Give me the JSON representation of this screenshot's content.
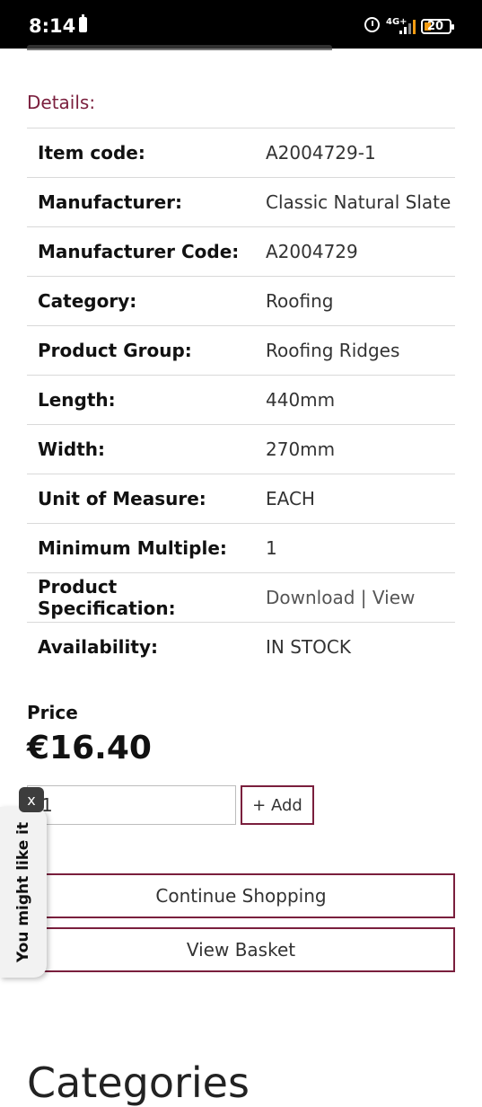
{
  "status_bar": {
    "time": "8:14",
    "network": "4G+",
    "battery": "20"
  },
  "details": {
    "heading": "Details:",
    "rows": [
      {
        "label": "Item code:",
        "value": "A2004729-1"
      },
      {
        "label": "Manufacturer:",
        "value": "Classic Natural Slate"
      },
      {
        "label": "Manufacturer Code:",
        "value": "A2004729"
      },
      {
        "label": "Category:",
        "value": "Roofing"
      },
      {
        "label": "Product Group:",
        "value": "Roofing Ridges"
      },
      {
        "label": "Length:",
        "value": "440mm"
      },
      {
        "label": "Width:",
        "value": "270mm"
      },
      {
        "label": "Unit of Measure:",
        "value": "EACH"
      },
      {
        "label": "Minimum Multiple:",
        "value": "1"
      },
      {
        "label": "Product Specification:",
        "download": "Download",
        "separator": "|",
        "view": "View"
      },
      {
        "label": "Availability:",
        "value": "IN STOCK"
      }
    ],
    "in_stock_color": "#1f7a1f"
  },
  "price": {
    "label": "Price",
    "value": "€16.40"
  },
  "cart": {
    "quantity": "1",
    "add_label": "+ Add"
  },
  "buttons": {
    "continue": "Continue Shopping",
    "view_basket": "View Basket"
  },
  "side_tab": {
    "label": "You might like it",
    "close": "x"
  },
  "categories": {
    "title": "Categories"
  },
  "colors": {
    "accent": "#7a1f3d"
  }
}
